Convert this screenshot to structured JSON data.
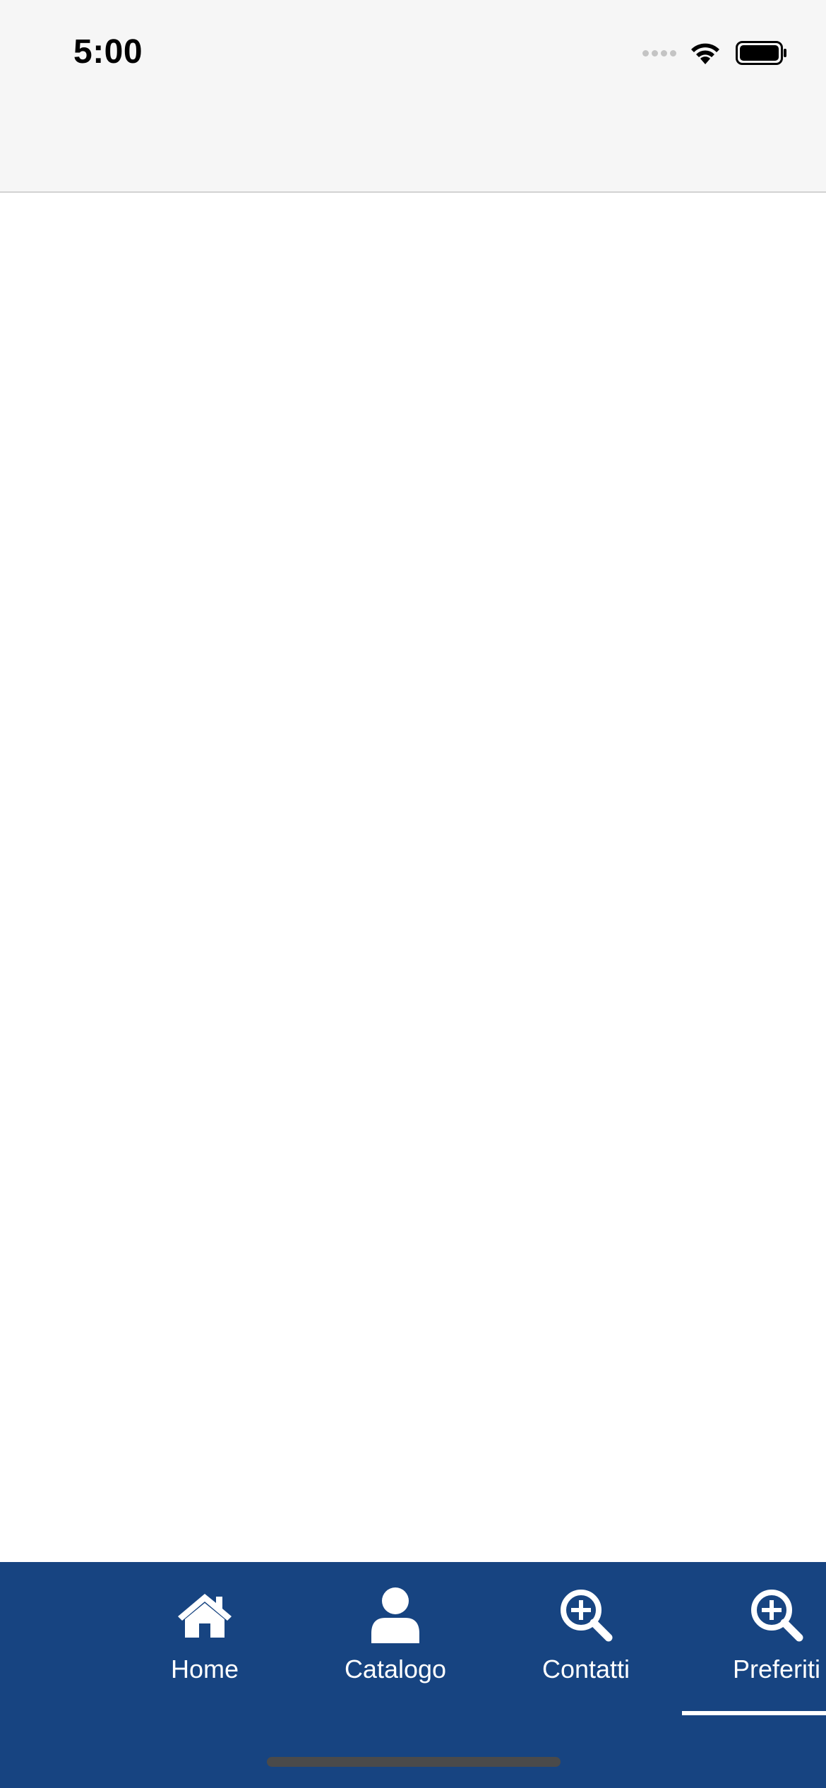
{
  "status_bar": {
    "time": "5:00",
    "icons": [
      "signal-dots-icon",
      "wifi-icon",
      "battery-icon"
    ]
  },
  "tab_bar": {
    "background_color": "#174481",
    "active_tab": "Preferiti",
    "tabs": [
      {
        "label": "Home",
        "icon": "home-icon"
      },
      {
        "label": "Catalogo",
        "icon": "user-icon"
      },
      {
        "label": "Contatti",
        "icon": "zoom-in-icon"
      },
      {
        "label": "Preferiti",
        "icon": "zoom-in-icon"
      }
    ]
  }
}
